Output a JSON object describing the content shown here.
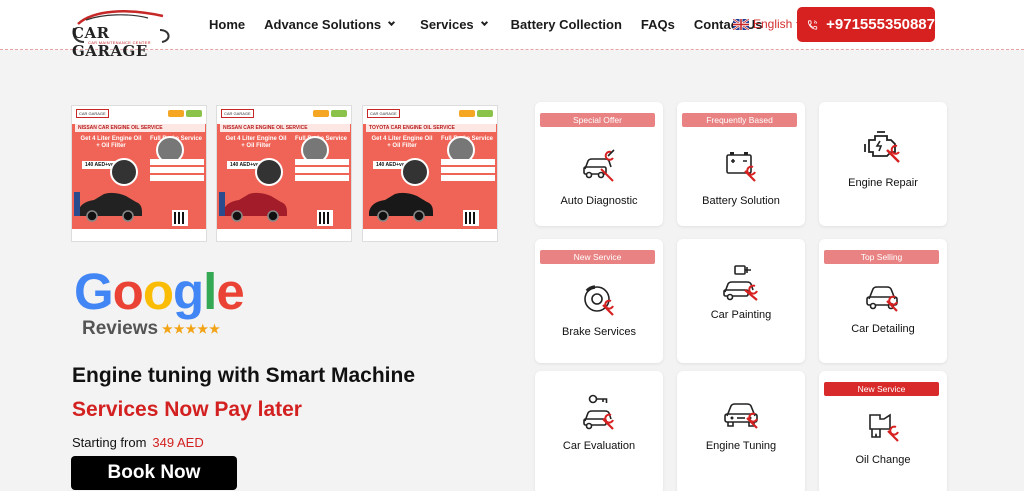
{
  "header": {
    "logo": {
      "name": "CAR GARAGE",
      "tagline": "CAR MAINTENANCE CENTER"
    },
    "nav": [
      {
        "label": "Home",
        "dropdown": false
      },
      {
        "label": "Advance Solutions",
        "dropdown": true
      },
      {
        "label": "Services",
        "dropdown": true
      },
      {
        "label": "Battery Collection",
        "dropdown": false
      },
      {
        "label": "FAQs",
        "dropdown": false
      },
      {
        "label": "Contact Us",
        "dropdown": false
      }
    ],
    "language": "English",
    "phone": "+971555350887"
  },
  "promos": [
    {
      "brand": "NISSAN",
      "strip": "CAR ENGINE OIL SERVICE",
      "oil_offer": "Get 4 Liter Engine Oil + Oil Filter",
      "price": "140 AED+vat",
      "brake_title": "Full Brake Service"
    },
    {
      "brand": "NISSAN",
      "strip": "CAR ENGINE OIL SERVICE",
      "oil_offer": "Get 4 Liter Engine Oil + Oil Filter",
      "price": "140 AED+vat",
      "brake_title": "Full Brake Service"
    },
    {
      "brand": "TOYOTA",
      "strip": "CAR ENGINE OIL SERVICE",
      "oil_offer": "Get 4 Liter Engine Oil + Oil Filter",
      "price": "140 AED+vat",
      "brake_title": "Full Brake Service"
    }
  ],
  "hero": {
    "google_word": "Google",
    "reviews_label": "Reviews",
    "stars": "★★★★★",
    "title": "Engine tuning with Smart Machine",
    "subtitle": "Services Now Pay later",
    "starting_label": "Starting from",
    "starting_price": "349 AED",
    "book_button": "Book Now"
  },
  "services": [
    {
      "label": "Auto Diagnostic",
      "badge": "Special Offer",
      "icon": "car-diagnostic-icon"
    },
    {
      "label": "Battery Solution",
      "badge": "Frequently Based",
      "icon": "battery-icon"
    },
    {
      "label": "Engine Repair",
      "badge": "",
      "icon": "engine-icon"
    },
    {
      "label": "Brake Services",
      "badge": "New Service",
      "icon": "brake-disc-icon"
    },
    {
      "label": "Car Painting",
      "badge": "",
      "icon": "spray-paint-icon"
    },
    {
      "label": "Car Detailing",
      "badge": "Top Selling",
      "icon": "car-detailing-icon"
    },
    {
      "label": "Car Evaluation",
      "badge": "",
      "icon": "car-evaluation-icon"
    },
    {
      "label": "Engine Tuning",
      "badge": "",
      "icon": "engine-tuning-icon"
    },
    {
      "label": "Oil Change",
      "badge": "New Service",
      "icon": "oil-change-icon"
    }
  ],
  "colors": {
    "accent": "#d72020",
    "badge_light": "#e98383",
    "badge_dark": "#d82a2a",
    "promo_bg": "#ef6456",
    "page_bg": "#f3f3f3"
  }
}
